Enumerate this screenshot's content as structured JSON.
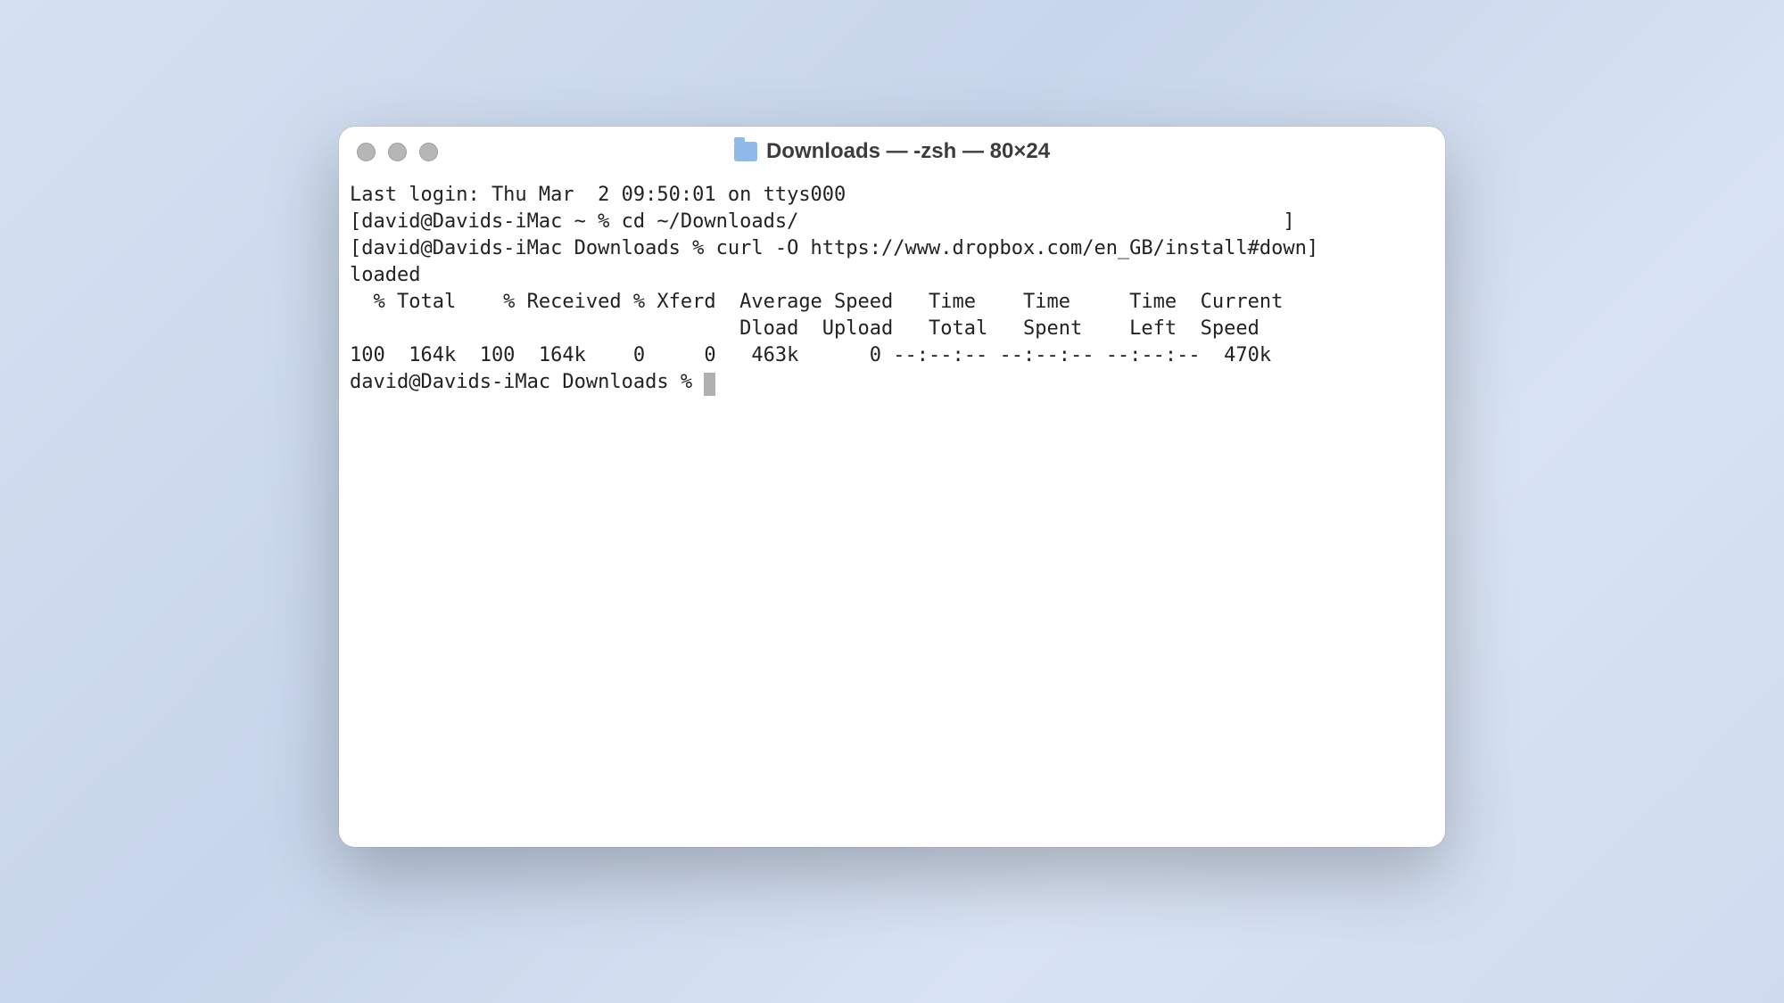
{
  "window": {
    "title": "Downloads — -zsh — 80×24"
  },
  "terminal": {
    "line1": "Last login: Thu Mar  2 09:50:01 on ttys000",
    "line2": "[david@Davids-iMac ~ % cd ~/Downloads/                                         ]",
    "line3": "[david@Davids-iMac Downloads % curl -O https://www.dropbox.com/en_GB/install#down]",
    "line4": "loaded",
    "line5": "  % Total    % Received % Xferd  Average Speed   Time    Time     Time  Current",
    "line6": "                                 Dload  Upload   Total   Spent    Left  Speed",
    "line7": "100  164k  100  164k    0     0   463k      0 --:--:-- --:--:-- --:--:--  470k",
    "prompt": "david@Davids-iMac Downloads % "
  }
}
